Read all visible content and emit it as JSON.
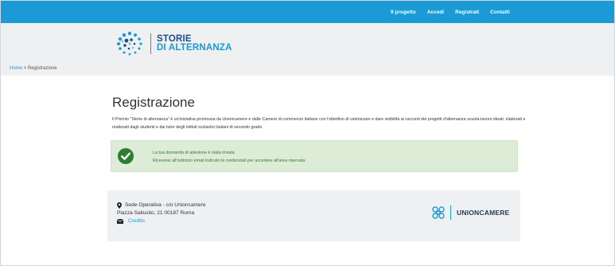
{
  "topnav": {
    "items": [
      {
        "label": "Il progetto"
      },
      {
        "label": "Accedi"
      },
      {
        "label": "Registrati"
      },
      {
        "label": "Contatti"
      }
    ]
  },
  "logo": {
    "line1": "STORIE",
    "line2": "DI ALTERNANZA"
  },
  "breadcrumb": {
    "home": "Home",
    "separator": " > ",
    "current": "Registrazione"
  },
  "main": {
    "title": "Registrazione",
    "intro": "Il Premio \"Storie di alternanza\" è un'iniziativa promossa da Unioncamere e dalle Camere di commercio italiane con l'obiettivo di valorizzare e dare visibilità ai racconti dei progetti d'alternanza scuola-lavoro ideati, elaborati e realizzati dagli studenti e dai tutor degli Istituti scolastici italiani di secondo grado.",
    "alert": {
      "line1": "La tua domanda di adesione è stata inviata",
      "line2": "Riceverai all'indirizzo email indicato le credenziali per accedere all'area riservata",
      "color": "#3c763d",
      "icon": "check-circle-icon"
    }
  },
  "footer": {
    "office": "Sede Operativa - c/o Unioncamere",
    "address": "Piazza Sallustio, 21 00187 Roma",
    "credits": "Credits",
    "partner": "UNIONCAMERE"
  },
  "colors": {
    "brand": "#1b9ad6",
    "navy": "#1a4f86",
    "success_bg": "#dcecd6"
  }
}
